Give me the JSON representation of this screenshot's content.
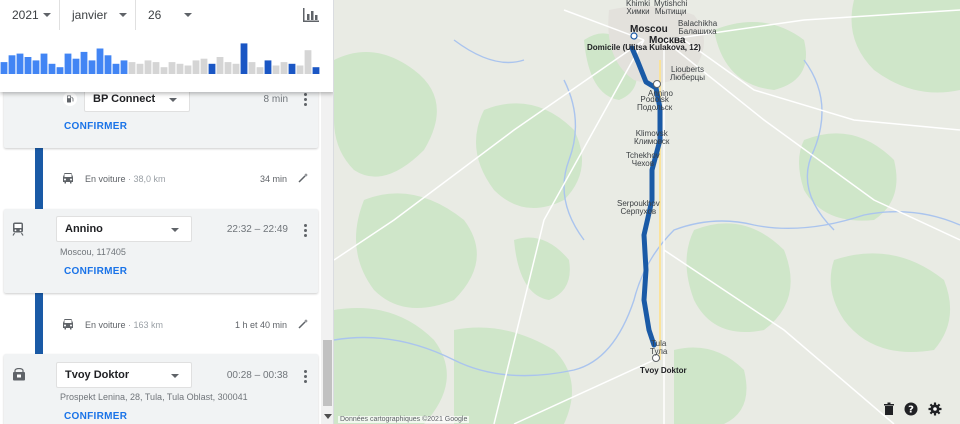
{
  "date": {
    "year": "2021",
    "month": "janvier",
    "day": "26"
  },
  "histogram": {
    "values": [
      0.35,
      0.55,
      0.6,
      0.5,
      0.4,
      0.6,
      0.3,
      0.2,
      0.6,
      0.45,
      0.65,
      0.4,
      0.75,
      0.55,
      0.3,
      0.4,
      0.35,
      0.3,
      0.4,
      0.35,
      0.2,
      0.35,
      0.3,
      0.25,
      0.4,
      0.45,
      0.3,
      0.5,
      0.35,
      0.3,
      0.9,
      0.35,
      0.2,
      0.4,
      0.25,
      0.35,
      0.3,
      0.25,
      0.7,
      0.2
    ],
    "highlight_color": "#4285f4",
    "muted_color": "#d5d5d5",
    "dark_color": "#1a56c4"
  },
  "stops": [
    {
      "name": "BP Connect",
      "duration": "8 min",
      "confirm": "CONFIRMER",
      "icon": "gas-station-icon"
    },
    {
      "name": "Annino",
      "time": "22:32 – 22:49",
      "address": "Moscou, 117405",
      "confirm": "CONFIRMER",
      "icon": "transit-icon"
    },
    {
      "name": "Tvoy Doktor",
      "time": "00:28 – 00:38",
      "address": "Prospekt Lenina, 28, Tula, Tula Oblast, 300041",
      "confirm": "CONFIRMER",
      "icon": "shop-icon"
    }
  ],
  "legs": [
    {
      "mode": "En voiture",
      "distance": " · 38,0 km",
      "duration": "34 min",
      "icon": "car-icon"
    },
    {
      "mode": "En voiture",
      "distance": " · 163 km",
      "duration": "1 h et 40 min",
      "icon": "car-icon"
    }
  ],
  "map": {
    "route_color": "#1a5aa6",
    "attribution": "Données cartographiques ©2021 Google",
    "labels": [
      [
        "Khimki",
        "Химки"
      ],
      [
        "Mytishchi",
        "Мытищи"
      ],
      [
        "Balachikha",
        "Балашиха"
      ],
      [
        "Moscou",
        "Москва"
      ],
      [
        "Domicile (Ulitsa Kulakova, 12)",
        ""
      ],
      [
        "Liouberts",
        "Люберцы"
      ],
      [
        "Annino",
        ""
      ],
      [
        "Podolsk",
        "Подольск"
      ],
      [
        "Klimovsk",
        "Климовск"
      ],
      [
        "Tchekhov",
        "Чехов"
      ],
      [
        "Serpoukhov",
        "Серпухов"
      ],
      [
        "Tula",
        "Тула"
      ],
      [
        "Tvoy Doktor",
        ""
      ]
    ]
  },
  "icons": {
    "map_delete": "trash-icon",
    "map_help": "help-icon",
    "map_settings": "gear-icon",
    "chart": "bar-chart-icon",
    "wand": "magic-wand-icon"
  }
}
